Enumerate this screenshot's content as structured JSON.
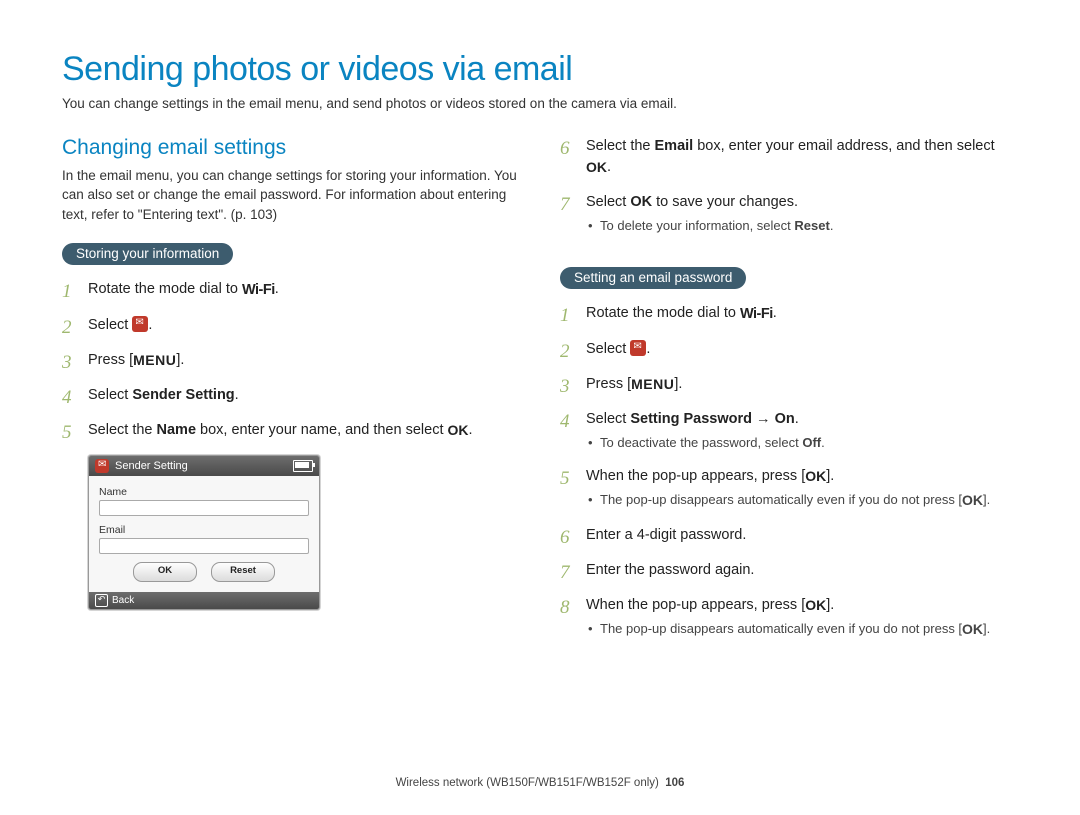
{
  "page_title": "Sending photos or videos via email",
  "intro": "You can change settings in the email menu, and send photos or videos stored on the camera via email.",
  "left": {
    "section_title": "Changing email settings",
    "section_desc": "In the email menu, you can change settings for storing your information. You can also set or change the email password. For information about entering text, refer to \"Entering text\". (p. 103)",
    "pill": "Storing your information",
    "steps": {
      "s1_a": "Rotate the mode dial to ",
      "s1_wifi": "Wi-Fi",
      "s1_b": ".",
      "s2": "Select ",
      "s2_b": ".",
      "s3_a": "Press [",
      "s3_menu": "MENU",
      "s3_b": "].",
      "s4_a": "Select ",
      "s4_bold": "Sender Setting",
      "s4_b": ".",
      "s5_a": "Select the ",
      "s5_bold": "Name",
      "s5_b": " box, enter your name, and then select ",
      "s5_ok": "OK",
      "s5_c": "."
    },
    "shot": {
      "title": "Sender Setting",
      "name": "Name",
      "email": "Email",
      "ok": "OK",
      "reset": "Reset",
      "back": "Back"
    }
  },
  "right": {
    "steps_top": {
      "s6_a": "Select the ",
      "s6_bold": "Email",
      "s6_b": " box, enter your email address, and then select ",
      "s6_ok": "OK",
      "s6_c": ".",
      "s7_a": "Select ",
      "s7_bold": "OK",
      "s7_b": " to save your changes.",
      "s7_sub_a": "To delete your information, select ",
      "s7_sub_bold": "Reset",
      "s7_sub_b": "."
    },
    "pill": "Setting an email password",
    "steps_pw": {
      "s1_a": "Rotate the mode dial to ",
      "s1_wifi": "Wi-Fi",
      "s1_b": ".",
      "s2": "Select ",
      "s2_b": ".",
      "s3_a": "Press [",
      "s3_menu": "MENU",
      "s3_b": "].",
      "s4_a": "Select ",
      "s4_bold": "Setting Password",
      "s4_arrow": " → ",
      "s4_bold2": "On",
      "s4_b": ".",
      "s4_sub_a": "To deactivate the password, select ",
      "s4_sub_bold": "Off",
      "s4_sub_b": ".",
      "s5_a": "When the pop-up appears, press [",
      "s5_ok": "OK",
      "s5_b": "].",
      "s5_sub_a": "The pop-up disappears automatically even if you do not press [",
      "s5_sub_ok": "OK",
      "s5_sub_b": "].",
      "s6": "Enter a 4-digit password.",
      "s7": "Enter the password again.",
      "s8_a": "When the pop-up appears, press [",
      "s8_ok": "OK",
      "s8_b": "].",
      "s8_sub_a": "The pop-up disappears automatically even if you do not press [",
      "s8_sub_ok": "OK",
      "s8_sub_b": "]."
    }
  },
  "footer": {
    "text": "Wireless network (WB150F/WB151F/WB152F only)",
    "page": "106"
  }
}
